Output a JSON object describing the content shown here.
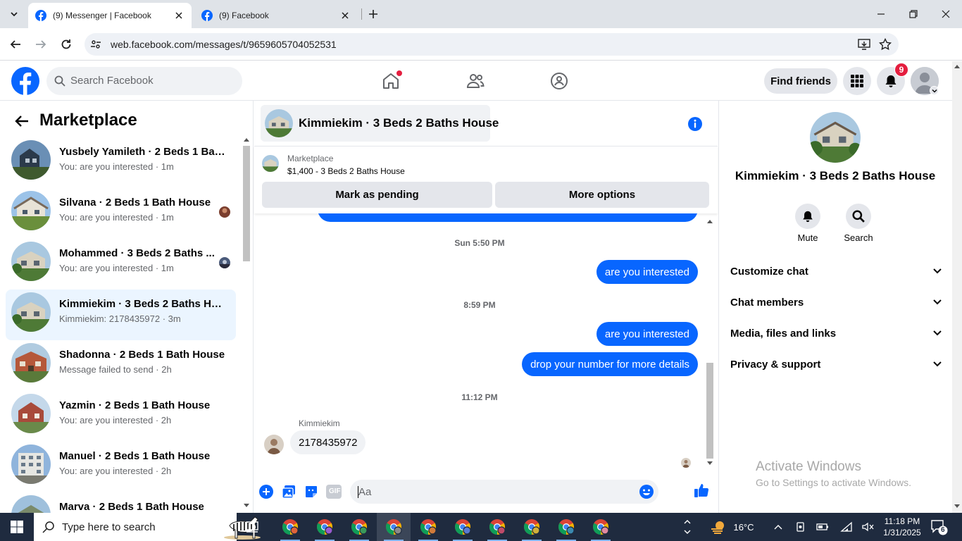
{
  "browser": {
    "tabs": [
      {
        "title": "(9) Messenger | Facebook",
        "active": true
      },
      {
        "title": "(9) Facebook",
        "active": false
      }
    ],
    "url": "web.facebook.com/messages/t/9659605704052531"
  },
  "fb_header": {
    "search_placeholder": "Search Facebook",
    "find_friends": "Find friends",
    "notification_count": "9",
    "accent": "#0866ff"
  },
  "left": {
    "title": "Marketplace",
    "conversations": [
      {
        "name": "Yusbely Yamileth · 2 Beds 1 Bath...",
        "sub": "You: are you interested · 1m"
      },
      {
        "name": "Silvana · 2 Beds 1 Bath House",
        "sub": "You: are you interested · 1m"
      },
      {
        "name": "Mohammed · 3 Beds 2 Baths ...",
        "sub": "You: are you interested · 1m"
      },
      {
        "name": "Kimmiekim · 3 Beds 2 Baths Ho...",
        "sub": "Kimmiekim: 2178435972 · 3m"
      },
      {
        "name": "Shadonna · 2 Beds 1 Bath House",
        "sub": "Message failed to send · 2h"
      },
      {
        "name": "Yazmin · 2 Beds 1 Bath House",
        "sub": "You: are you interested · 2h"
      },
      {
        "name": "Manuel · 2 Beds 1 Bath House",
        "sub": "You: are you interested · 2h"
      },
      {
        "name": "Marva · 2 Beds 1 Bath House",
        "sub": ""
      }
    ]
  },
  "chat": {
    "title": "Kimmiekim · 3 Beds 2 Baths House",
    "marketplace_label": "Marketplace",
    "listing": "$1,400 - 3 Beds 2 Baths House",
    "mark_pending": "Mark as pending",
    "more_options": "More options",
    "ts1": "Sun 5:50 PM",
    "msg1": "are you interested",
    "ts2": "8:59 PM",
    "msg2": "are you interested",
    "msg3": "drop your number for more details",
    "ts3": "11:12 PM",
    "sender": "Kimmiekim",
    "reply": "2178435972",
    "input_placeholder": "Aa",
    "gif_label": "GIF"
  },
  "right": {
    "name": "Kimmiekim · 3 Beds 2 Baths House",
    "mute": "Mute",
    "search": "Search",
    "sections": [
      "Customize chat",
      "Chat members",
      "Media, files and links",
      "Privacy & support"
    ]
  },
  "watermark": {
    "line1": "Activate Windows",
    "line2": "Go to Settings to activate Windows."
  },
  "taskbar": {
    "search_placeholder": "Type here to search",
    "weather": "16°C",
    "time": "11:18 PM",
    "date": "1/31/2025",
    "notif_count": "6"
  }
}
